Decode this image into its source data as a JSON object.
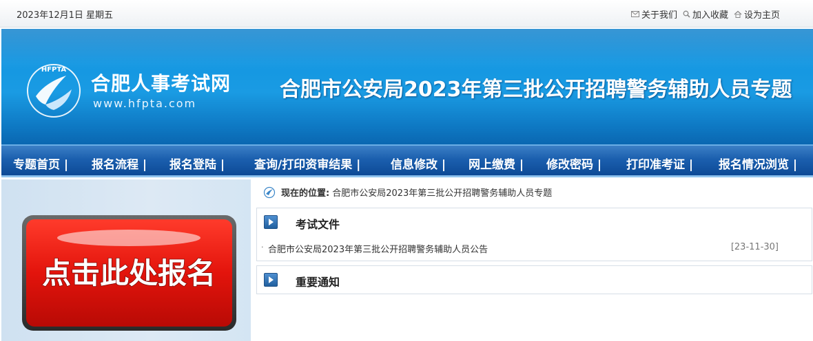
{
  "topbar": {
    "date": "2023年12月1日 星期五",
    "links": [
      {
        "label": "关于我们",
        "icon": "mail-icon"
      },
      {
        "label": "加入收藏",
        "icon": "search-icon"
      },
      {
        "label": "设为主页",
        "icon": "home-icon"
      }
    ]
  },
  "banner": {
    "logo_text": "HFPTA",
    "site_name": "合肥人事考试网",
    "site_url": "www.hfpta.com",
    "title": "合肥市公安局2023年第三批公开招聘警务辅助人员专题"
  },
  "nav": {
    "items": [
      "专题首页 |",
      "报名流程 |",
      "报名登陆 |",
      "查询/打印资审结果 |",
      "信息修改 |",
      "网上缴费 |",
      "修改密码 |",
      "打印准考证 |",
      "报名情况浏览 |"
    ]
  },
  "sidebar": {
    "signup_button": "点击此处报名"
  },
  "breadcrumb": {
    "label": "现在的位置:",
    "path": "合肥市公安局2023年第三批公开招聘警务辅助人员专题"
  },
  "sections": [
    {
      "title": "考试文件",
      "items": [
        {
          "text": "合肥市公安局2023年第三批公开招聘警务辅助人员公告",
          "date": "[23-11-30]"
        }
      ]
    },
    {
      "title": "重要通知",
      "items": []
    }
  ],
  "colors": {
    "banner_blue": "#1497e2",
    "nav_blue": "#1b5fae",
    "signup_red": "#e3140c"
  }
}
